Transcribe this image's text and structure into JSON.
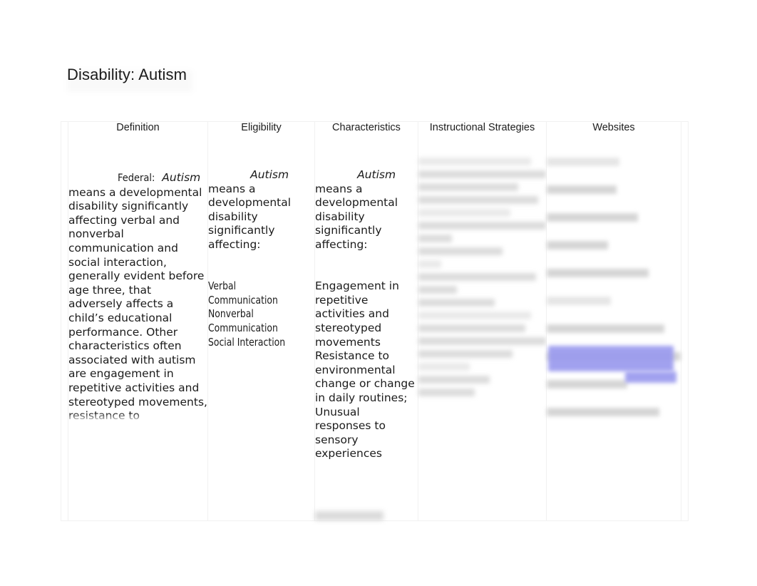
{
  "document": {
    "title": "Disability: Autism"
  },
  "table": {
    "columns": [
      {
        "id": "definition",
        "header": "Definition"
      },
      {
        "id": "eligibility",
        "header": "Eligibility"
      },
      {
        "id": "characteristics",
        "header": "Characteristics"
      },
      {
        "id": "instructional_strategies",
        "header": "Instructional Strategies"
      },
      {
        "id": "websites",
        "header": "Websites"
      }
    ],
    "cells": {
      "definition": {
        "label": "Federal:",
        "term": "Autism",
        "body": " means a developmental disability significantly affecting verbal and nonverbal communication and social interaction, generally evident before age three, that adversely affects a child’s educational performance. Other characteristics often associated with autism are engagement in repetitive activities and stereotyped movements, resistance to environmental change",
        "truncated": "clipped"
      },
      "eligibility": {
        "term": "Autism",
        "lead": " means a developmental disability significantly affecting:",
        "items": "Verbal Communication\nNonverbal Communication\nSocial Interaction"
      },
      "characteristics": {
        "term": "Autism",
        "lead": " means a developmental disability significantly affecting:",
        "body": "Engagement in repetitive activities and stereotyped movements\nResistance to environmental change or change in daily routines;\nUnusual responses to sensory experiences"
      },
      "instructional_strategies": {
        "content_state": "blurred",
        "line_widths": [
          88,
          100,
          78,
          94,
          72,
          100,
          26,
          66,
          18,
          92,
          30,
          60,
          88,
          84,
          100,
          74,
          40,
          56,
          44
        ]
      },
      "websites": {
        "content_state": "blurred",
        "line_widths": [
          54,
          52,
          68,
          46,
          76,
          48,
          88,
          100,
          60,
          84
        ],
        "selection_highlight_color": "#9a9aee"
      }
    }
  }
}
